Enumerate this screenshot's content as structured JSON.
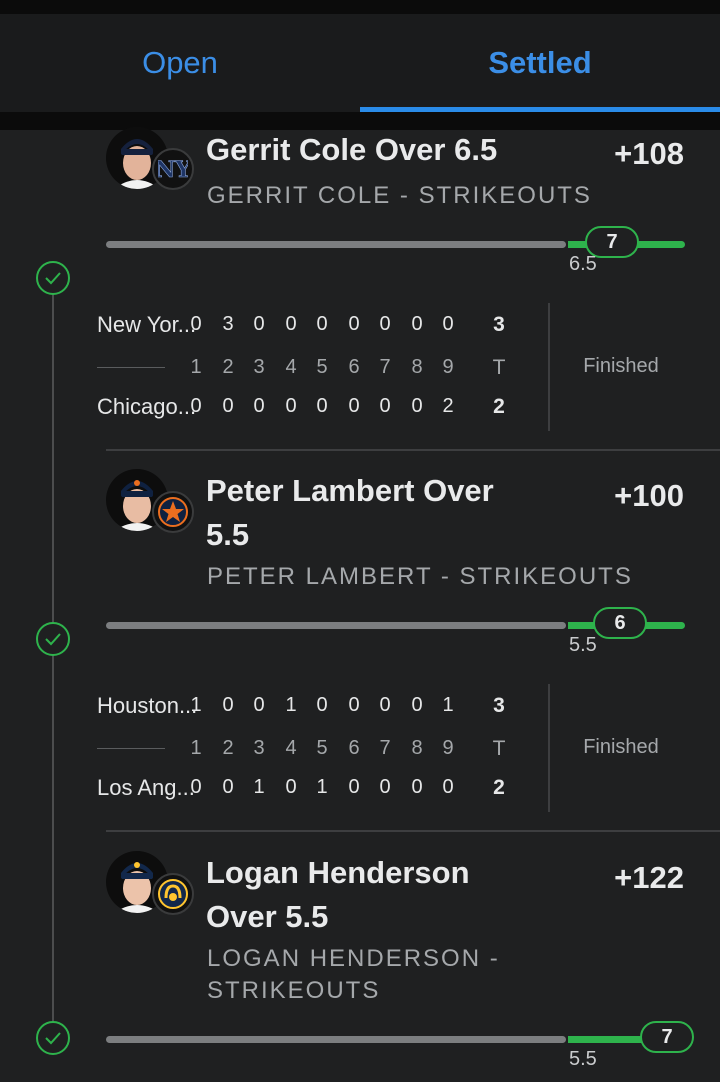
{
  "tabs": {
    "open": "Open",
    "settled": "Settled",
    "active": "Settled"
  },
  "colors": {
    "accent_blue": "#3b8ee6",
    "win_green": "#2eb34c",
    "background": "#1f2021"
  },
  "picks": [
    {
      "title": "Gerrit Cole Over 6.5",
      "subtitle": "GERRIT COLE - STRIKEOUTS",
      "odds": "+108",
      "line": "6.5",
      "result": "7",
      "team_icon": "yankees-logo-icon",
      "status": "won"
    },
    {
      "title_line1": "Peter Lambert Over",
      "title_line2": "5.5",
      "subtitle": "PETER LAMBERT - STRIKEOUTS",
      "odds": "+100",
      "line": "5.5",
      "result": "6",
      "team_icon": "astros-logo-icon",
      "status": "won"
    },
    {
      "title_line1": "Logan Henderson",
      "title_line2": "Over 5.5",
      "subtitle_line1": "LOGAN HENDERSON -",
      "subtitle_line2": "STRIKEOUTS",
      "odds": "+122",
      "line": "5.5",
      "result": "7",
      "team_icon": "brewers-logo-icon",
      "status": "won"
    }
  ],
  "games": [
    {
      "away_name": "New Yor...",
      "away_innings": [
        "0",
        "3",
        "0",
        "0",
        "0",
        "0",
        "0",
        "0",
        "0"
      ],
      "away_total": "3",
      "home_name": "Chicago...",
      "home_innings": [
        "0",
        "0",
        "0",
        "0",
        "0",
        "0",
        "0",
        "0",
        "2"
      ],
      "home_total": "2",
      "status": "Finished"
    },
    {
      "away_name": "Houston...",
      "away_innings": [
        "1",
        "0",
        "0",
        "1",
        "0",
        "0",
        "0",
        "0",
        "1"
      ],
      "away_total": "3",
      "home_name": "Los Ang...",
      "home_innings": [
        "0",
        "0",
        "1",
        "0",
        "1",
        "0",
        "0",
        "0",
        "0"
      ],
      "home_total": "2",
      "status": "Finished"
    }
  ],
  "innings_header": [
    "1",
    "2",
    "3",
    "4",
    "5",
    "6",
    "7",
    "8",
    "9"
  ],
  "total_header": "T"
}
